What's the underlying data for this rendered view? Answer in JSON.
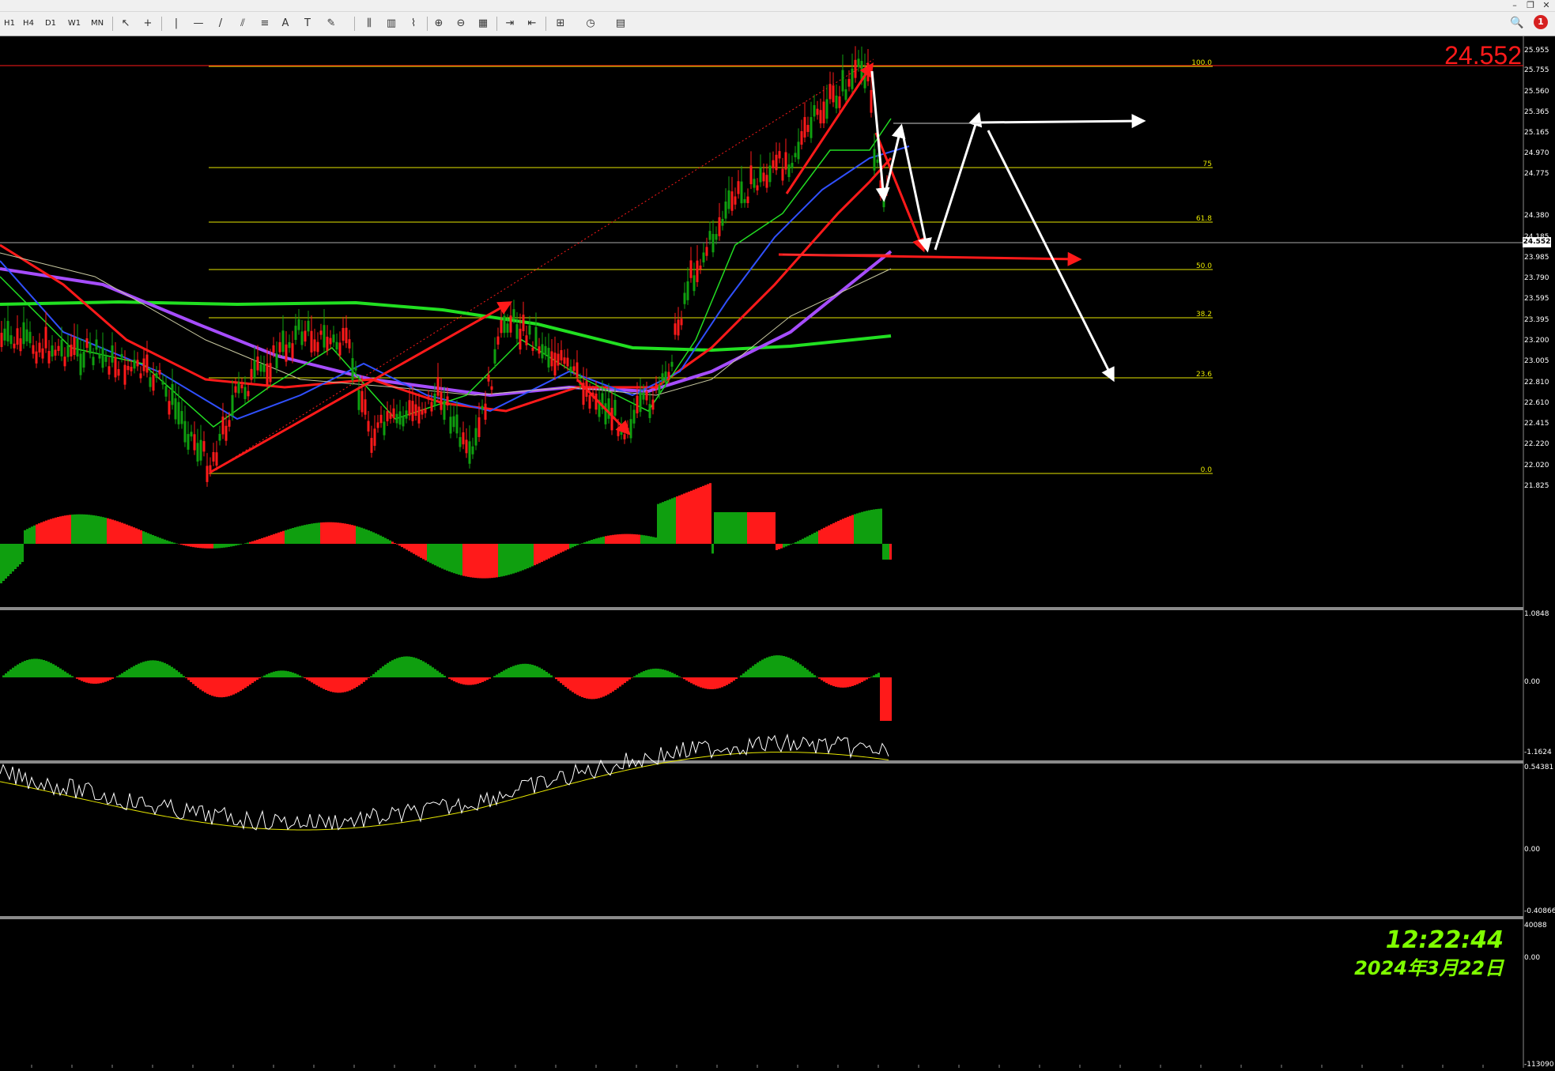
{
  "window": {
    "controls": {
      "minimize": "–",
      "restore": "❐",
      "close": "✕"
    }
  },
  "toolbar": {
    "timeframes": [
      "H1",
      "H4",
      "D1",
      "W1",
      "MN"
    ],
    "tool_glyphs": {
      "cursor": "↖",
      "crosshair": "+",
      "vline": "|",
      "hline": "—",
      "trendline": "/",
      "channel": "⫽",
      "fibonacci": "≡",
      "text": "A",
      "label": "T",
      "shapes": "✎",
      "bar_chart": "⫼",
      "candles": "▥",
      "line_chart": "⌇",
      "zoom_in": "⊕",
      "zoom_out": "⊖",
      "tile": "▦",
      "autoscroll": "⇥",
      "shift": "⇤",
      "indicators": "⊞",
      "periods": "◷",
      "templates": "▤"
    },
    "notification_count": "1"
  },
  "chart": {
    "current_price": "24.552",
    "current_price_tag": "24.552",
    "price_axis": [
      "25.955",
      "25.755",
      "25.560",
      "25.365",
      "25.165",
      "24.970",
      "24.775",
      "24.380",
      "24.185",
      "23.985",
      "23.790",
      "23.595",
      "23.395",
      "23.200",
      "23.005",
      "22.810",
      "22.610",
      "22.415",
      "22.220",
      "22.020",
      "21.825"
    ],
    "fib_levels": [
      "100.0",
      "75",
      "61.8",
      "50.0",
      "38.2",
      "23.6",
      "0.0"
    ],
    "colors": {
      "background": "#000000",
      "fib": "#e6e600",
      "bull": "#0f9f0f",
      "bear": "#ff1a1a",
      "ma_green": "#21e021",
      "ma_purple": "#a64dff",
      "arrow_white": "#ffffff"
    }
  },
  "macd": {
    "axis_top": "1.0848",
    "axis_zero": "0.00",
    "axis_bottom": "-1.1624"
  },
  "osc": {
    "axis_top": "0.54381",
    "axis_zero": "0.00",
    "axis_bottom": "-0.40866"
  },
  "volume": {
    "axis_top": "40088",
    "axis_zero": "0.00",
    "axis_bottom": "-113090"
  },
  "clock": {
    "time": "12:22:44",
    "date": "2024年3月22日"
  }
}
